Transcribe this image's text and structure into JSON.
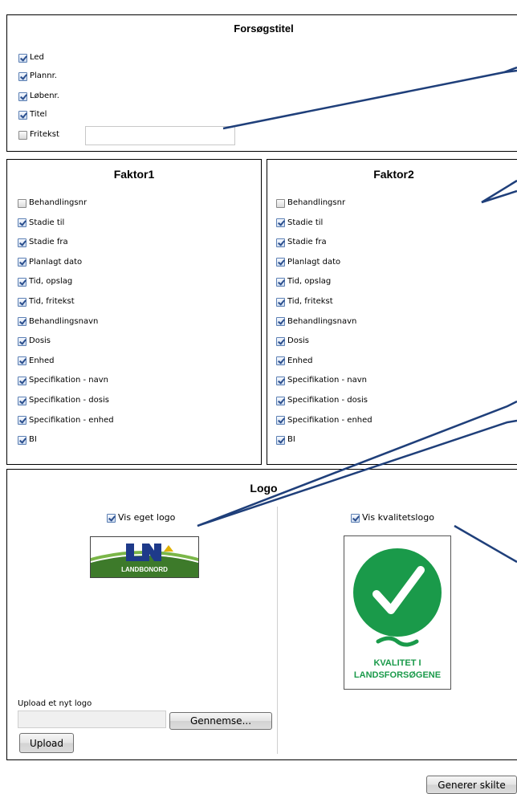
{
  "title_section": {
    "heading": "Forsøgstitel",
    "items": [
      {
        "label": "Led",
        "checked": true
      },
      {
        "label": "Plannr.",
        "checked": true
      },
      {
        "label": "Løbenr.",
        "checked": true
      },
      {
        "label": "Titel",
        "checked": true
      },
      {
        "label": "Fritekst",
        "checked": false
      }
    ],
    "fritekst_value": ""
  },
  "factor1": {
    "heading": "Faktor1",
    "items": [
      {
        "label": "Behandlingsnr",
        "checked": false
      },
      {
        "label": "Stadie til",
        "checked": true
      },
      {
        "label": "Stadie fra",
        "checked": true
      },
      {
        "label": "Planlagt dato",
        "checked": true
      },
      {
        "label": "Tid, opslag",
        "checked": true
      },
      {
        "label": "Tid, fritekst",
        "checked": true
      },
      {
        "label": "Behandlingsnavn",
        "checked": true
      },
      {
        "label": "Dosis",
        "checked": true
      },
      {
        "label": "Enhed",
        "checked": true
      },
      {
        "label": "Specifikation - navn",
        "checked": true
      },
      {
        "label": "Specifikation - dosis",
        "checked": true
      },
      {
        "label": "Specifikation - enhed",
        "checked": true
      },
      {
        "label": "BI",
        "checked": true
      }
    ]
  },
  "factor2": {
    "heading": "Faktor2",
    "items": [
      {
        "label": "Behandlingsnr",
        "checked": false
      },
      {
        "label": "Stadie til",
        "checked": true
      },
      {
        "label": "Stadie fra",
        "checked": true
      },
      {
        "label": "Planlagt dato",
        "checked": true
      },
      {
        "label": "Tid, opslag",
        "checked": true
      },
      {
        "label": "Tid, fritekst",
        "checked": true
      },
      {
        "label": "Behandlingsnavn",
        "checked": true
      },
      {
        "label": "Dosis",
        "checked": true
      },
      {
        "label": "Enhed",
        "checked": true
      },
      {
        "label": "Specifikation - navn",
        "checked": true
      },
      {
        "label": "Specifikation - dosis",
        "checked": true
      },
      {
        "label": "Specifikation - enhed",
        "checked": true
      },
      {
        "label": "BI",
        "checked": true
      }
    ]
  },
  "logo_section": {
    "heading": "Logo",
    "own_logo": {
      "label": "Vis eget logo",
      "checked": true,
      "logo_text": "LANDBONORD"
    },
    "quality_logo": {
      "label": "Vis kvalitetslogo",
      "checked": true,
      "line1": "KVALITET I",
      "line2": "LANDSFORSØGENE"
    },
    "upload_label": "Upload et nyt logo",
    "file_value": "",
    "browse_button": "Gennemse...",
    "upload_button": "Upload"
  },
  "generate_button": "Generer skilte",
  "colors": {
    "callout": "#1f3f7a",
    "landbonord_green": "#3d7a2a",
    "landbonord_blue": "#1e3a8a",
    "quality_green": "#1a9a4a"
  }
}
